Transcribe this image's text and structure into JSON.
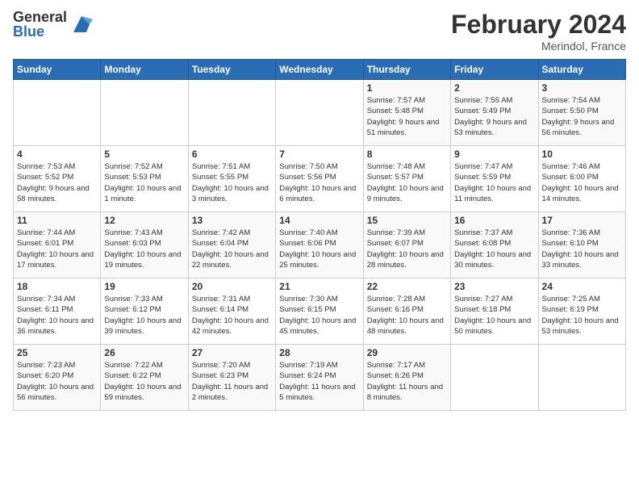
{
  "header": {
    "logo_general": "General",
    "logo_blue": "Blue",
    "month_title": "February 2024",
    "location": "Merindol, France"
  },
  "days_of_week": [
    "Sunday",
    "Monday",
    "Tuesday",
    "Wednesday",
    "Thursday",
    "Friday",
    "Saturday"
  ],
  "weeks": [
    [
      {
        "day": "",
        "info": ""
      },
      {
        "day": "",
        "info": ""
      },
      {
        "day": "",
        "info": ""
      },
      {
        "day": "",
        "info": ""
      },
      {
        "day": "1",
        "info": "Sunrise: 7:57 AM\nSunset: 5:48 PM\nDaylight: 9 hours and 51 minutes."
      },
      {
        "day": "2",
        "info": "Sunrise: 7:55 AM\nSunset: 5:49 PM\nDaylight: 9 hours and 53 minutes."
      },
      {
        "day": "3",
        "info": "Sunrise: 7:54 AM\nSunset: 5:50 PM\nDaylight: 9 hours and 56 minutes."
      }
    ],
    [
      {
        "day": "4",
        "info": "Sunrise: 7:53 AM\nSunset: 5:52 PM\nDaylight: 9 hours and 58 minutes."
      },
      {
        "day": "5",
        "info": "Sunrise: 7:52 AM\nSunset: 5:53 PM\nDaylight: 10 hours and 1 minute."
      },
      {
        "day": "6",
        "info": "Sunrise: 7:51 AM\nSunset: 5:55 PM\nDaylight: 10 hours and 3 minutes."
      },
      {
        "day": "7",
        "info": "Sunrise: 7:50 AM\nSunset: 5:56 PM\nDaylight: 10 hours and 6 minutes."
      },
      {
        "day": "8",
        "info": "Sunrise: 7:48 AM\nSunset: 5:57 PM\nDaylight: 10 hours and 9 minutes."
      },
      {
        "day": "9",
        "info": "Sunrise: 7:47 AM\nSunset: 5:59 PM\nDaylight: 10 hours and 11 minutes."
      },
      {
        "day": "10",
        "info": "Sunrise: 7:46 AM\nSunset: 6:00 PM\nDaylight: 10 hours and 14 minutes."
      }
    ],
    [
      {
        "day": "11",
        "info": "Sunrise: 7:44 AM\nSunset: 6:01 PM\nDaylight: 10 hours and 17 minutes."
      },
      {
        "day": "12",
        "info": "Sunrise: 7:43 AM\nSunset: 6:03 PM\nDaylight: 10 hours and 19 minutes."
      },
      {
        "day": "13",
        "info": "Sunrise: 7:42 AM\nSunset: 6:04 PM\nDaylight: 10 hours and 22 minutes."
      },
      {
        "day": "14",
        "info": "Sunrise: 7:40 AM\nSunset: 6:06 PM\nDaylight: 10 hours and 25 minutes."
      },
      {
        "day": "15",
        "info": "Sunrise: 7:39 AM\nSunset: 6:07 PM\nDaylight: 10 hours and 28 minutes."
      },
      {
        "day": "16",
        "info": "Sunrise: 7:37 AM\nSunset: 6:08 PM\nDaylight: 10 hours and 30 minutes."
      },
      {
        "day": "17",
        "info": "Sunrise: 7:36 AM\nSunset: 6:10 PM\nDaylight: 10 hours and 33 minutes."
      }
    ],
    [
      {
        "day": "18",
        "info": "Sunrise: 7:34 AM\nSunset: 6:11 PM\nDaylight: 10 hours and 36 minutes."
      },
      {
        "day": "19",
        "info": "Sunrise: 7:33 AM\nSunset: 6:12 PM\nDaylight: 10 hours and 39 minutes."
      },
      {
        "day": "20",
        "info": "Sunrise: 7:31 AM\nSunset: 6:14 PM\nDaylight: 10 hours and 42 minutes."
      },
      {
        "day": "21",
        "info": "Sunrise: 7:30 AM\nSunset: 6:15 PM\nDaylight: 10 hours and 45 minutes."
      },
      {
        "day": "22",
        "info": "Sunrise: 7:28 AM\nSunset: 6:16 PM\nDaylight: 10 hours and 48 minutes."
      },
      {
        "day": "23",
        "info": "Sunrise: 7:27 AM\nSunset: 6:18 PM\nDaylight: 10 hours and 50 minutes."
      },
      {
        "day": "24",
        "info": "Sunrise: 7:25 AM\nSunset: 6:19 PM\nDaylight: 10 hours and 53 minutes."
      }
    ],
    [
      {
        "day": "25",
        "info": "Sunrise: 7:23 AM\nSunset: 6:20 PM\nDaylight: 10 hours and 56 minutes."
      },
      {
        "day": "26",
        "info": "Sunrise: 7:22 AM\nSunset: 6:22 PM\nDaylight: 10 hours and 59 minutes."
      },
      {
        "day": "27",
        "info": "Sunrise: 7:20 AM\nSunset: 6:23 PM\nDaylight: 11 hours and 2 minutes."
      },
      {
        "day": "28",
        "info": "Sunrise: 7:19 AM\nSunset: 6:24 PM\nDaylight: 11 hours and 5 minutes."
      },
      {
        "day": "29",
        "info": "Sunrise: 7:17 AM\nSunset: 6:26 PM\nDaylight: 11 hours and 8 minutes."
      },
      {
        "day": "",
        "info": ""
      },
      {
        "day": "",
        "info": ""
      }
    ]
  ]
}
